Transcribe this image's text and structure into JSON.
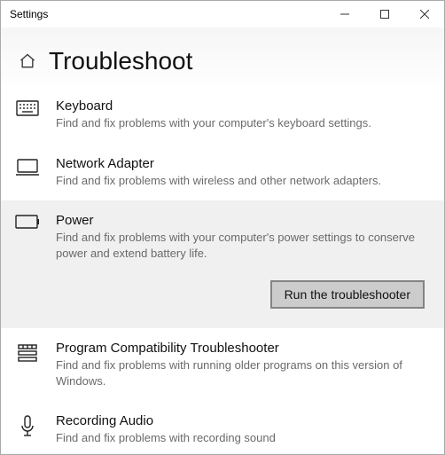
{
  "window": {
    "title": "Settings"
  },
  "page": {
    "heading": "Troubleshoot"
  },
  "items": [
    {
      "name": "Keyboard",
      "desc": "Find and fix problems with your computer's keyboard settings."
    },
    {
      "name": "Network Adapter",
      "desc": "Find and fix problems with wireless and other network adapters."
    },
    {
      "name": "Power",
      "desc": "Find and fix problems with your computer's power settings to conserve power and extend battery life.",
      "button": "Run the troubleshooter"
    },
    {
      "name": "Program Compatibility Troubleshooter",
      "desc": "Find and fix problems with running older programs on this version of Windows."
    },
    {
      "name": "Recording Audio",
      "desc": "Find and fix problems with recording sound"
    }
  ]
}
